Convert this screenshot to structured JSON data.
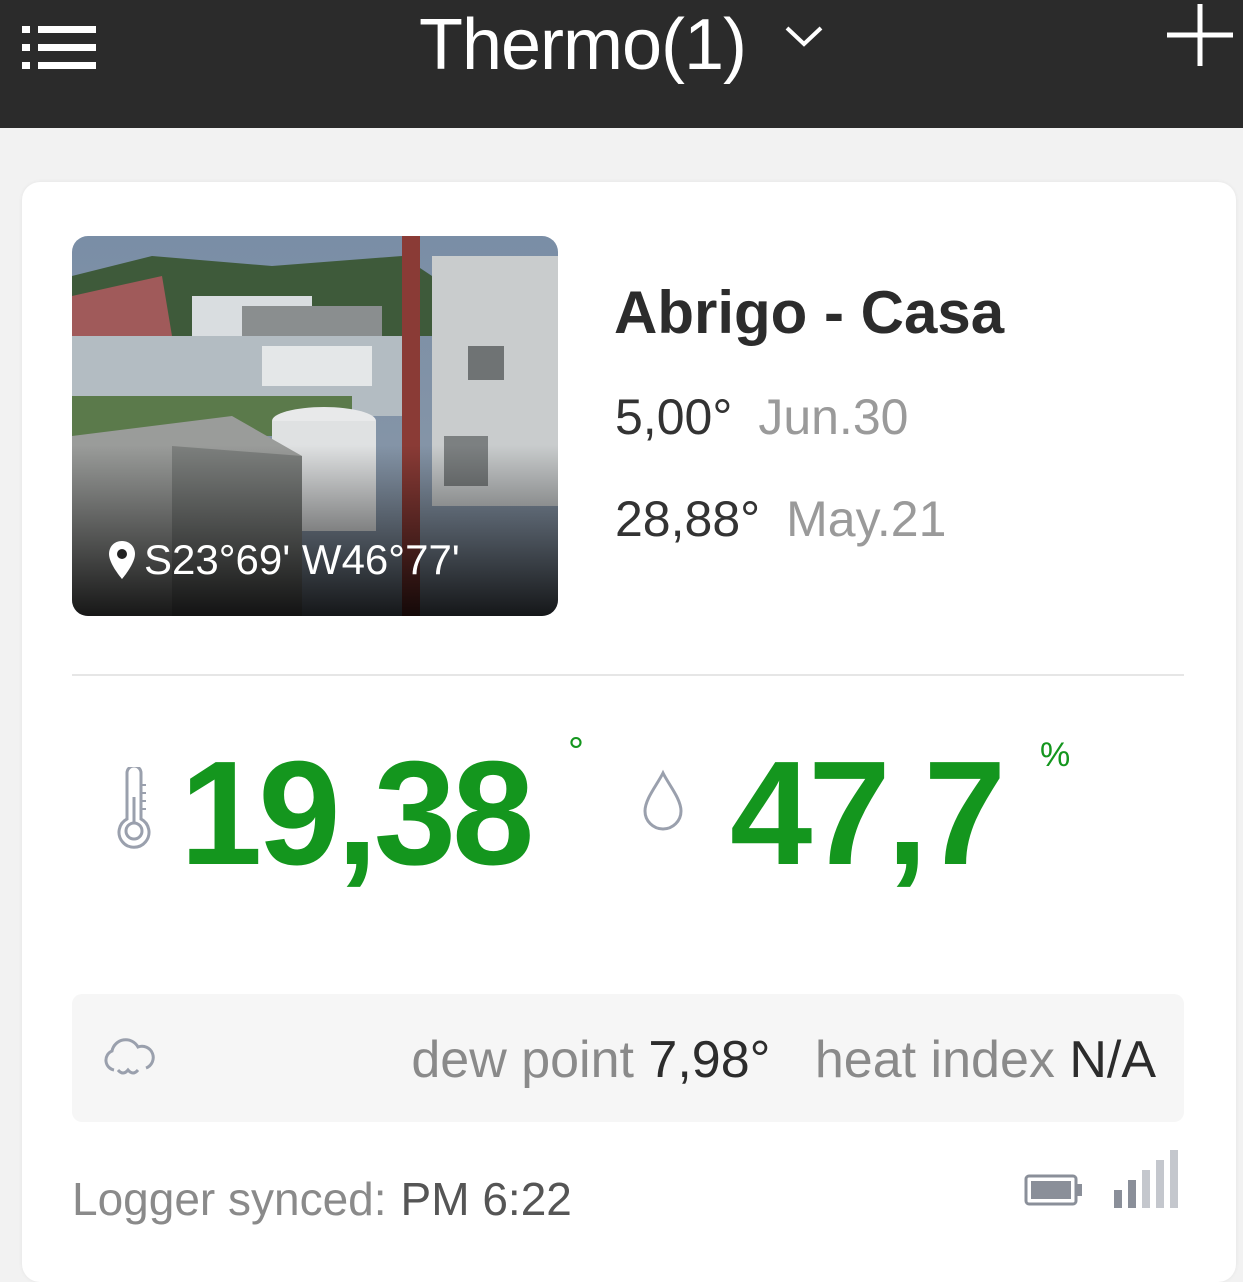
{
  "header": {
    "title": "Thermo(1)",
    "menu_icon": "list-icon",
    "dropdown_icon": "chevron-down-icon",
    "add_icon": "plus-icon",
    "background": "#2b2b2b"
  },
  "device": {
    "name": "Abrigo - Casa",
    "coordinates": "S23°69' W46°77'",
    "min_value": "5,00°",
    "min_date": "Jun.30",
    "max_value": "28,88°",
    "max_date": "May.21"
  },
  "readings": {
    "temperature": "19,38",
    "temperature_unit": "°",
    "humidity": "47,7",
    "humidity_unit": "%",
    "accent_color": "#14961e"
  },
  "info": {
    "dew_point_label": "dew point",
    "dew_point_value": "7,98°",
    "heat_index_label": "heat index",
    "heat_index_value": "N/A"
  },
  "footer": {
    "sync_label": "Logger synced:",
    "sync_time": "PM 6:22"
  }
}
